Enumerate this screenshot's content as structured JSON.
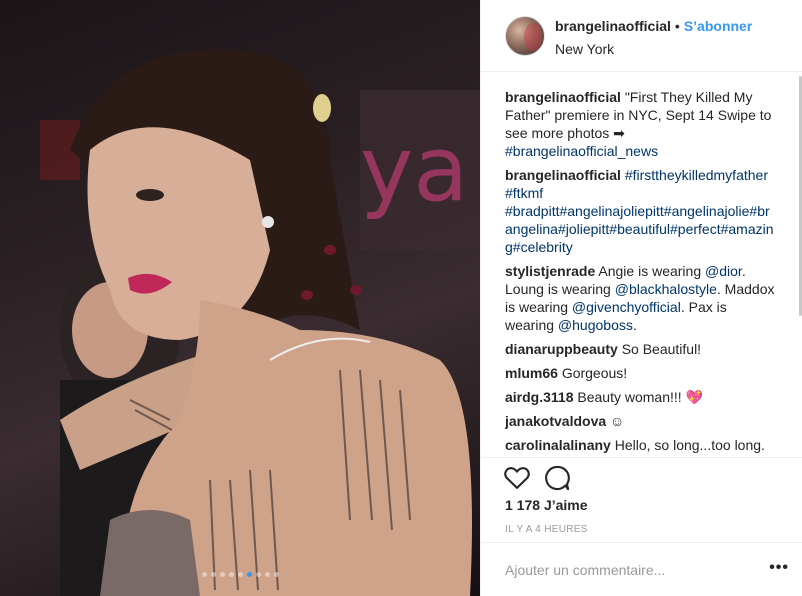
{
  "photo": {
    "alt": "",
    "slide_count": 9,
    "active_slide": 5
  },
  "header": {
    "username": "brangelinaofficial",
    "separator": "•",
    "follow_label": "S’abonner",
    "location": "New York"
  },
  "comments": [
    {
      "author": "brangelinaofficial",
      "parts": [
        {
          "t": "\"First They Killed My Father\" premiere in NYC, Sept 14 Swipe to see more photos ➡ "
        },
        {
          "t": "#brangelinaofficial_news",
          "link": true
        }
      ]
    },
    {
      "author": "brangelinaofficial",
      "parts": [
        {
          "t": "#firsttheykilledmyfather",
          "link": true
        },
        {
          "t": " "
        },
        {
          "t": "#ftkmf",
          "link": true
        },
        {
          "t": " "
        },
        {
          "t": "#bradpitt#angelinajoliepitt#angelinajolie#brangelina#joliepitt#beautiful#perfect#amazing#celebrity",
          "link": true
        }
      ]
    },
    {
      "author": "stylistjenrade",
      "parts": [
        {
          "t": "Angie is wearing "
        },
        {
          "t": "@dior",
          "link": true
        },
        {
          "t": ". Loung is wearing "
        },
        {
          "t": "@blackhalostyle",
          "link": true
        },
        {
          "t": ". Maddox is wearing "
        },
        {
          "t": "@givenchyofficial",
          "link": true
        },
        {
          "t": ". Pax is wearing "
        },
        {
          "t": "@hugoboss",
          "link": true
        },
        {
          "t": "."
        }
      ]
    },
    {
      "author": "dianaruppbeauty",
      "parts": [
        {
          "t": "So Beautiful!"
        }
      ]
    },
    {
      "author": "mlum66",
      "parts": [
        {
          "t": "Gorgeous!"
        }
      ]
    },
    {
      "author": "airdg.3118",
      "parts": [
        {
          "t": "Beauty woman!!! 💖"
        }
      ]
    },
    {
      "author": "janakotvaldova",
      "parts": [
        {
          "t": "☺"
        }
      ]
    },
    {
      "author": "carolinalalinany",
      "parts": [
        {
          "t": "Hello, so long...too long."
        }
      ]
    }
  ],
  "actions": {
    "like_icon": "heart-icon",
    "comment_icon": "speech-bubble-icon"
  },
  "likes": {
    "count": "1 178",
    "label": "J’aime"
  },
  "timestamp": "IL Y A 4 HEURES",
  "add_comment": {
    "placeholder": "Ajouter un commentaire...",
    "more_label": "•••"
  }
}
